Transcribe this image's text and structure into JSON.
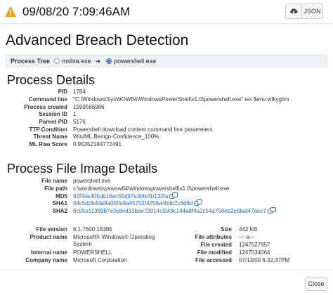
{
  "header": {
    "timestamp": "09/08/20 7:09:46AM",
    "json_label": "JSON",
    "warning_icon": "warning-icon",
    "download_icon": "cloud-download-icon"
  },
  "page_title": "Advanced Breach Detection",
  "process_tree": {
    "label": "Process Tree",
    "parent": "mshta.exe",
    "child": "powershell.exe"
  },
  "process_details": {
    "title": "Process Details",
    "rows": [
      {
        "label": "PID",
        "value": "1784"
      },
      {
        "label": "Command line",
        "value": "\"C:\\Windows\\SysWOW64\\WindowsPowerShell\\v1.0\\powershell.exe\" iex $env:wfkygtim"
      },
      {
        "label": "Process created",
        "value": "1599566986"
      },
      {
        "label": "Session ID",
        "value": "1"
      },
      {
        "label": "Parent PID",
        "value": "5176"
      },
      {
        "label": "TTP Condition",
        "value": "Powershell download content command line parameters"
      },
      {
        "label": "Threat Name",
        "value": "Win/ML.Benign-Confidence_100%"
      },
      {
        "label": "ML Raw Score",
        "value": "0.95352184772491"
      }
    ]
  },
  "file_details": {
    "title": "Process File Image Details",
    "rows": [
      {
        "label": "File name",
        "value": "powershell.exe"
      },
      {
        "label": "File path",
        "value": "c:\\windows\\syswow64\\windowspowershell\\v1.0\\powershell.exe"
      },
      {
        "label": "MD5",
        "value": "92f44e405db16ac55d97e3bfe3b132fa"
      },
      {
        "label": "SHA1",
        "value": "04c5d2b4da9a0f3fa8a45702f4256a4bdb2c8d8d"
      },
      {
        "label": "SHA2",
        "value": "6c05e11399b7e3c8ed31bae72014cf249c144a8f4a2c54a758eb2e6fad47aec7"
      }
    ],
    "left_rows": [
      {
        "label": "File version",
        "value": "6.1.7600.16385"
      },
      {
        "label": "Product name",
        "value": "Microsoft® Windows® Operating System"
      },
      {
        "label": "Internal name",
        "value": "POWERSHELL"
      },
      {
        "label": "Company name",
        "value": "Microsoft Corporation"
      }
    ],
    "right_rows": [
      {
        "label": "Size",
        "value": "442 KB"
      },
      {
        "label": "File attributes",
        "value": "----a---"
      },
      {
        "label": "File created",
        "value": "1247527957"
      },
      {
        "label": "File modified",
        "value": "1247534064"
      },
      {
        "label": "File accessed",
        "value": "07/13/09 6:32:37PM"
      }
    ]
  },
  "footer": {
    "close_label": "Close"
  },
  "colors": {
    "warning": "#f0a020",
    "link": "#2a6dbf",
    "tree_bar_bg": "#eef2f7"
  }
}
